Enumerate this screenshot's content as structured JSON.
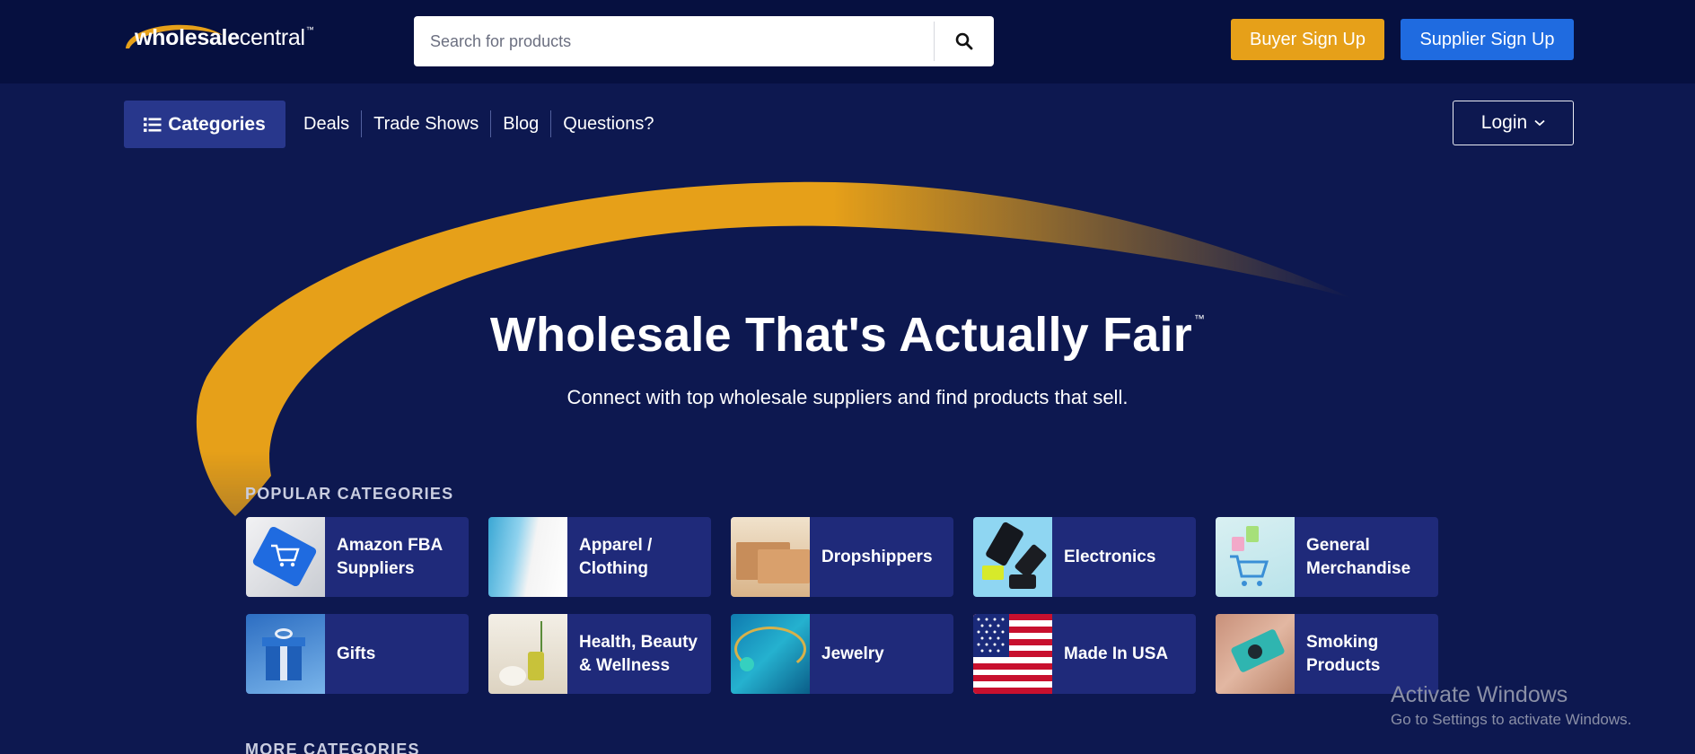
{
  "header": {
    "logo": {
      "word1": "wholesale",
      "word2": "central",
      "tm": "™"
    },
    "search": {
      "placeholder": "Search for products"
    },
    "buyer_signup_label": "Buyer Sign Up",
    "supplier_signup_label": "Supplier Sign Up"
  },
  "nav": {
    "categories_label": "Categories",
    "items": [
      "Deals",
      "Trade Shows",
      "Blog",
      "Questions?"
    ],
    "login_label": "Login"
  },
  "hero": {
    "title": "Wholesale That's Actually Fair",
    "title_tm": "™",
    "subtitle": "Connect with top wholesale suppliers and find products that sell."
  },
  "popular": {
    "title": "POPULAR CATEGORIES",
    "categories": [
      "Amazon FBA Suppliers",
      "Apparel / Clothing",
      "Dropshippers",
      "Electronics",
      "General Merchandise",
      "Gifts",
      "Health, Beauty & Wellness",
      "Jewelry",
      "Made In USA",
      "Smoking Products"
    ]
  },
  "more": {
    "title": "MORE CATEGORIES"
  },
  "watermark": {
    "line1": "Activate Windows",
    "line2": "Go to Settings to activate Windows."
  },
  "colors": {
    "page_bg": "#0d1850",
    "topbar_bg": "#061040",
    "card_bg": "#1f2a7a",
    "accent_gold": "#e6a019",
    "accent_blue": "#1f6be0"
  }
}
